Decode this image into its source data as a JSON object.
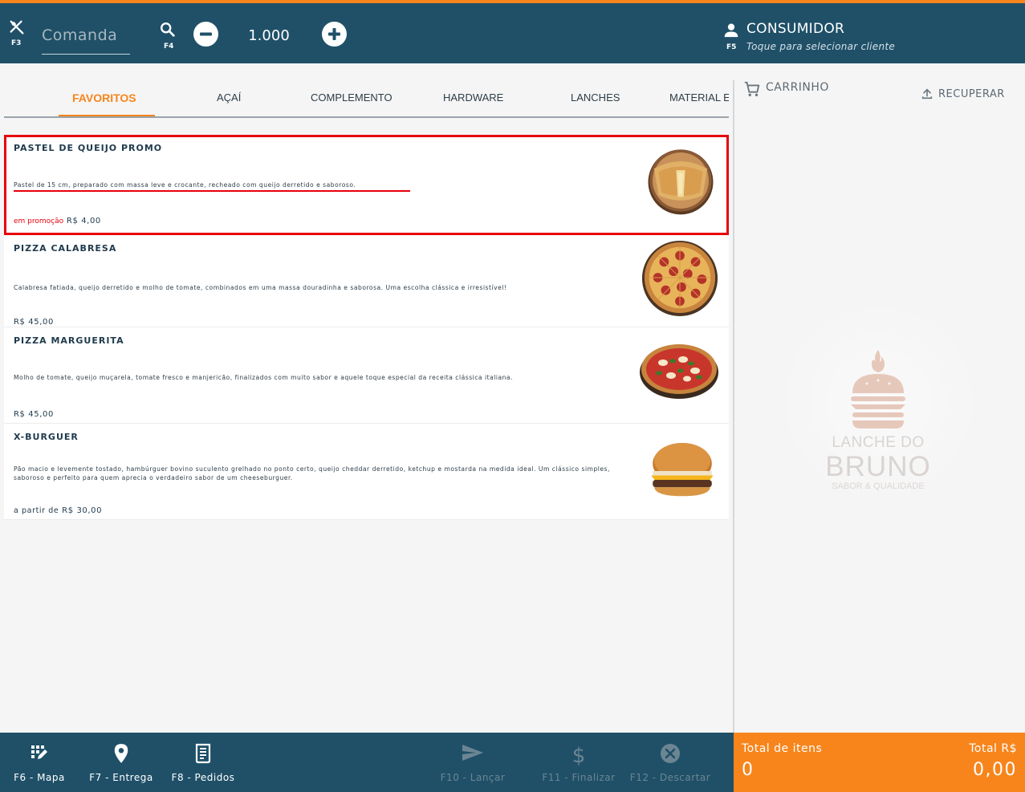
{
  "header": {
    "tables_hotkey": "F3",
    "comanda_placeholder": "Comanda",
    "search_hotkey": "F4",
    "quantity": "1.000",
    "customer_hotkey": "F5",
    "customer_name": "CONSUMIDOR",
    "customer_hint": "Toque para selecionar cliente"
  },
  "tabs": [
    {
      "label": "FAVORITOS",
      "active": true
    },
    {
      "label": "AÇAÍ"
    },
    {
      "label": "COMPLEMENTO"
    },
    {
      "label": "HARDWARE"
    },
    {
      "label": "LANCHES"
    },
    {
      "label": "MATERIAL E"
    }
  ],
  "products": [
    {
      "name": "PASTEL DE QUEIJO PROMO",
      "description": "Pastel de 15 cm, preparado com massa leve e crocante, recheado com queijo derretido e saboroso.",
      "promo_label": "em promoção",
      "price": "R$ 4,00",
      "image": "pastel-image",
      "highlighted": true
    },
    {
      "name": "PIZZA CALABRESA",
      "description": "Calabresa fatiada, queijo derretido e molho de tomate, combinados em uma massa douradinha e saborosa. Uma escolha clássica e irresistível!",
      "price": "R$ 45,00",
      "image": "pizza-calabresa-image"
    },
    {
      "name": "PIZZA MARGUERITA",
      "description": "Molho de tomate, queijo muçarela, tomate fresco e manjericão, finalizados com muito sabor e aquele toque especial da receita clássica italiana.",
      "price": "R$ 45,00",
      "image": "pizza-marguerita-image"
    },
    {
      "name": "X-BURGUER",
      "description": "Pão macio e levemente tostado, hambúrguer bovino suculento grelhado no ponto certo, queijo cheddar derretido, ketchup e mostarda na medida ideal. Um clássico simples, saboroso e perfeito para quem aprecia o verdadeiro sabor de um cheeseburguer.",
      "price_prefix": "a partir de",
      "price": "R$ 30,00",
      "image": "burger-image"
    }
  ],
  "cart": {
    "title": "CARRINHO",
    "recover_label": "RECUPERAR",
    "logo_line1": "LANCHE DO",
    "logo_line2": "BRUNO",
    "logo_line3": "SABOR & QUALIDADE"
  },
  "footer": {
    "map": "F6 - Mapa",
    "delivery": "F7 - Entrega",
    "orders": "F8 - Pedidos",
    "send": "F10 - Lançar",
    "finish": "F11 - Finalizar",
    "discard": "F12 - Descartar"
  },
  "totals": {
    "items_label": "Total de itens",
    "items_value": "0",
    "amount_label": "Total R$",
    "amount_value": "0,00"
  },
  "colors": {
    "primary": "#1f5068",
    "accent": "#f7851c",
    "highlight": "#e8000b"
  }
}
